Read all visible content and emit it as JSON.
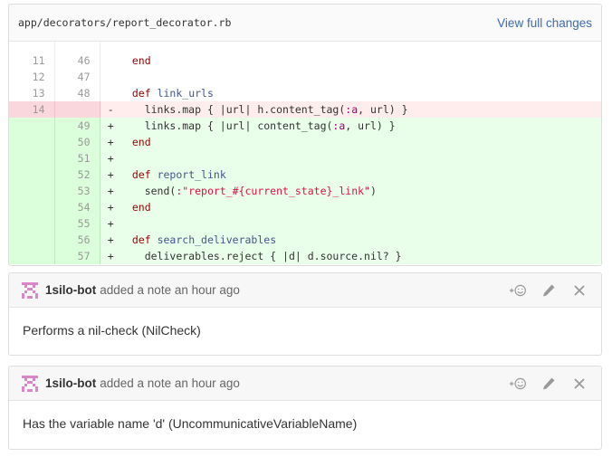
{
  "file": {
    "path": "app/decorators/report_decorator.rb",
    "view_full_changes": "View full changes"
  },
  "diff": {
    "rows": [
      {
        "type": "ctx",
        "old": "11",
        "new": "46",
        "sign": "",
        "indent": "  ",
        "tokens": [
          {
            "c": "kw",
            "t": "end"
          }
        ]
      },
      {
        "type": "ctx",
        "old": "12",
        "new": "47",
        "sign": "",
        "indent": "",
        "tokens": []
      },
      {
        "type": "ctx",
        "old": "13",
        "new": "48",
        "sign": "",
        "indent": "  ",
        "tokens": [
          {
            "c": "kw",
            "t": "def"
          },
          {
            "c": "",
            "t": " "
          },
          {
            "c": "fn",
            "t": "link_urls"
          }
        ]
      },
      {
        "type": "del",
        "old": "14",
        "new": "",
        "sign": "-",
        "indent": "    ",
        "tokens": [
          {
            "c": "",
            "t": "links.map { |url| h.content_tag("
          },
          {
            "c": "sym",
            "t": ":a"
          },
          {
            "c": "",
            "t": ", url) }"
          }
        ]
      },
      {
        "type": "add",
        "old": "",
        "new": "49",
        "sign": "+",
        "indent": "    ",
        "tokens": [
          {
            "c": "",
            "t": "links.map { |url| content_tag("
          },
          {
            "c": "sym",
            "t": ":a"
          },
          {
            "c": "",
            "t": ", url) }"
          }
        ]
      },
      {
        "type": "add",
        "old": "",
        "new": "50",
        "sign": "+",
        "indent": "  ",
        "tokens": [
          {
            "c": "kw",
            "t": "end"
          }
        ]
      },
      {
        "type": "add",
        "old": "",
        "new": "51",
        "sign": "+",
        "indent": "",
        "tokens": []
      },
      {
        "type": "add",
        "old": "",
        "new": "52",
        "sign": "+",
        "indent": "  ",
        "tokens": [
          {
            "c": "kw",
            "t": "def"
          },
          {
            "c": "",
            "t": " "
          },
          {
            "c": "fn",
            "t": "report_link"
          }
        ]
      },
      {
        "type": "add",
        "old": "",
        "new": "53",
        "sign": "+",
        "indent": "    ",
        "tokens": [
          {
            "c": "",
            "t": "send("
          },
          {
            "c": "str",
            "t": ":\"report_#{current_state}_link\""
          },
          {
            "c": "",
            "t": ")"
          }
        ]
      },
      {
        "type": "add",
        "old": "",
        "new": "54",
        "sign": "+",
        "indent": "  ",
        "tokens": [
          {
            "c": "kw",
            "t": "end"
          }
        ]
      },
      {
        "type": "add",
        "old": "",
        "new": "55",
        "sign": "+",
        "indent": "",
        "tokens": []
      },
      {
        "type": "add",
        "old": "",
        "new": "56",
        "sign": "+",
        "indent": "  ",
        "tokens": [
          {
            "c": "kw",
            "t": "def"
          },
          {
            "c": "",
            "t": " "
          },
          {
            "c": "fn",
            "t": "search_deliverables"
          }
        ]
      },
      {
        "type": "add",
        "old": "",
        "new": "57",
        "sign": "+",
        "indent": "    ",
        "tokens": [
          {
            "c": "",
            "t": "deliverables.reject { |d| d.source.nil? }"
          }
        ]
      }
    ]
  },
  "notes": [
    {
      "author": "1silo-bot",
      "meta": "added a note an hour ago",
      "body": "Performs a nil-check (NilCheck)"
    },
    {
      "author": "1silo-bot",
      "meta": "added a note an hour ago",
      "body": "Has the variable name 'd' (UncommunicativeVariableName)"
    }
  ],
  "icons": {
    "avatar": "identicon-avatar",
    "reaction": "add-emoji-icon",
    "edit": "pencil-icon",
    "delete": "close-icon"
  },
  "colors": {
    "link": "#3f6ba8",
    "deleted_bg": "#ffecec",
    "added_bg": "#eaffea",
    "keyword": "#990000",
    "function": "#445588",
    "symbol": "#990073",
    "string": "#dd1144",
    "avatar": "#d987c9"
  }
}
